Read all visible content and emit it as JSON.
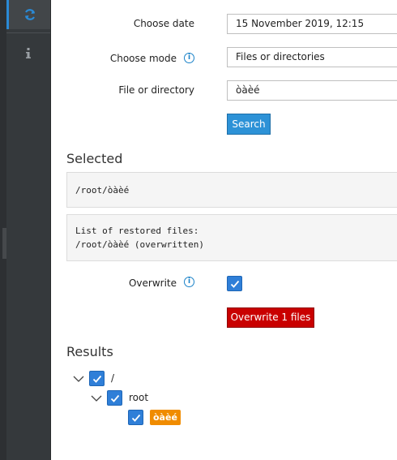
{
  "form": {
    "date_label": "Choose date",
    "date_value": "15 November 2019, 12:15",
    "mode_label": "Choose mode",
    "mode_value": "Files or directories",
    "path_label": "File or directory",
    "path_value": "òàèé",
    "search_label": "Search"
  },
  "selected": {
    "title": "Selected",
    "path": "/root/òàèé",
    "restored_line1": "List of restored files:",
    "restored_line2": "/root/òàèé (overwritten)"
  },
  "overwrite": {
    "label": "Overwrite",
    "checked": true,
    "button_label": "Overwrite 1 files"
  },
  "results": {
    "title": "Results",
    "tree": [
      {
        "label": "/",
        "checked": true
      },
      {
        "label": "root",
        "checked": true
      },
      {
        "label": "òàèé",
        "checked": true
      }
    ]
  },
  "icons": {
    "sidebar_active": "refresh-icon",
    "sidebar_second": "info-icon",
    "accent": "#2a8ad6"
  }
}
